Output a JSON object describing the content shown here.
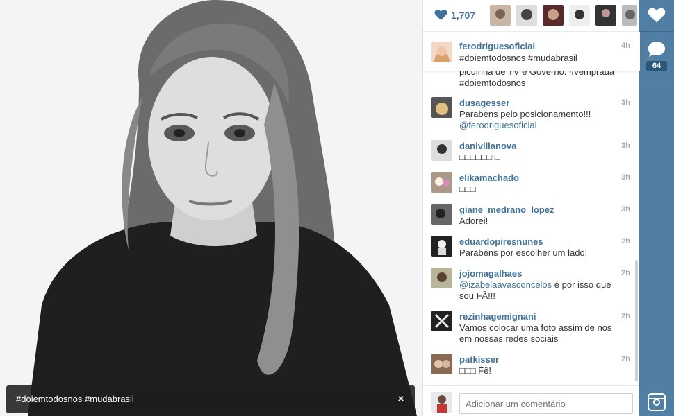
{
  "photo": {
    "caption_overlay": "#doiemtodosnos #mudabrasil",
    "close_label": "×"
  },
  "likes": {
    "count": "1,707",
    "icon": "heart-icon"
  },
  "caption": {
    "username": "ferodriguesoficial",
    "text": "#doiemtodosnos #mudabrasil",
    "time": "4h"
  },
  "partial_comment": {
    "text": "picuinha de TV e Governo. #vempraua #doiemtodosnos"
  },
  "comments": [
    {
      "username": "dusagesser",
      "text": "Parabens pelo posicionamento!!!",
      "mention": "@ferodriguesoficial",
      "time": "3h"
    },
    {
      "username": "danivillanova",
      "text": "□□□□□□ □",
      "time": "3h"
    },
    {
      "username": "elikamachado",
      "text": "□□□",
      "time": "3h"
    },
    {
      "username": "giane_medrano_lopez",
      "text": "Adorei!",
      "time": "3h"
    },
    {
      "username": "eduardopiresnunes",
      "text": "Parabéns por escolher um lado!",
      "time": "2h"
    },
    {
      "username": "jojomagalhaes",
      "mention": "@izabelaavasconcelos",
      "text": " é por isso que sou FÃ!!!",
      "time": "2h"
    },
    {
      "username": "rezinhagemignani",
      "text": "Vamos colocar uma foto assim de nos em nossas redes sociais",
      "time": "2h"
    },
    {
      "username": "patkisser",
      "text": "□□□ Fê!",
      "time": "2h"
    }
  ],
  "composer": {
    "placeholder": "Adicionar um comentário"
  },
  "rail": {
    "comments_count": "64"
  },
  "colors": {
    "link_blue": "#3f729b",
    "rail_blue": "#517fa4"
  }
}
